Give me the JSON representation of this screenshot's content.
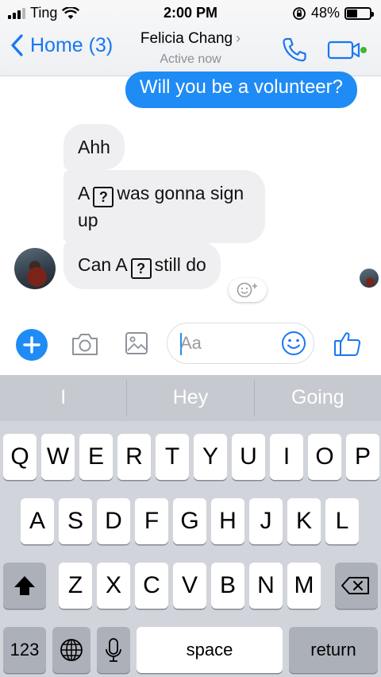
{
  "status_bar": {
    "carrier": "Ting",
    "time": "2:00 PM",
    "battery": "48%",
    "battery_level": 0.48
  },
  "header": {
    "back_label": "Home (3)",
    "contact_name": "Felicia Chang",
    "contact_status": "Active now",
    "accent_color": "#1877f2"
  },
  "messages": {
    "outgoing": [
      {
        "text": "Will you be a volunteer?"
      }
    ],
    "incoming": [
      {
        "text": "Ahh"
      },
      {
        "parts": [
          "A",
          "?",
          "was gonna sign up"
        ]
      },
      {
        "parts": [
          "Can A",
          "?",
          "still do"
        ]
      }
    ],
    "missing_glyph": "?"
  },
  "composer": {
    "placeholder": "Aa",
    "value": ""
  },
  "keyboard": {
    "suggestions": [
      "I",
      "Hey",
      "Going"
    ],
    "rows": [
      [
        "Q",
        "W",
        "E",
        "R",
        "T",
        "Y",
        "U",
        "I",
        "O",
        "P"
      ],
      [
        "A",
        "S",
        "D",
        "F",
        "G",
        "H",
        "J",
        "K",
        "L"
      ],
      [
        "Z",
        "X",
        "C",
        "V",
        "B",
        "N",
        "M"
      ]
    ],
    "numbers_label": "123",
    "space_label": "space",
    "return_label": "return"
  }
}
